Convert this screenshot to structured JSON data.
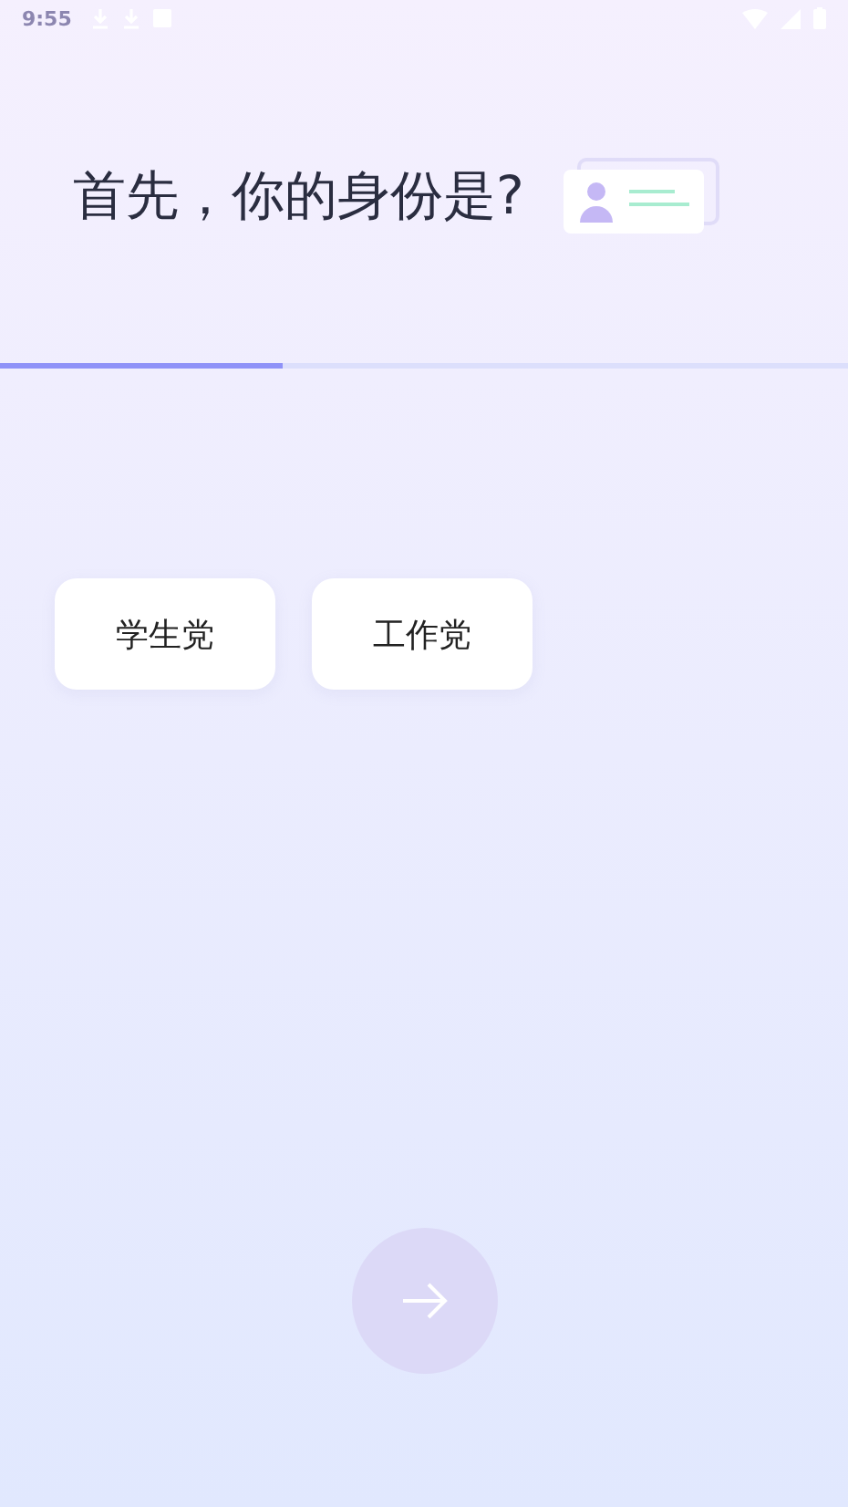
{
  "status_bar": {
    "time": "9:55"
  },
  "title": "首先，你的身份是?",
  "progress": {
    "level": 0.333
  },
  "options": [
    {
      "label": "学生党",
      "selected": false
    },
    {
      "label": "工作党",
      "selected": false
    }
  ],
  "next_button": {
    "disabled": true
  }
}
